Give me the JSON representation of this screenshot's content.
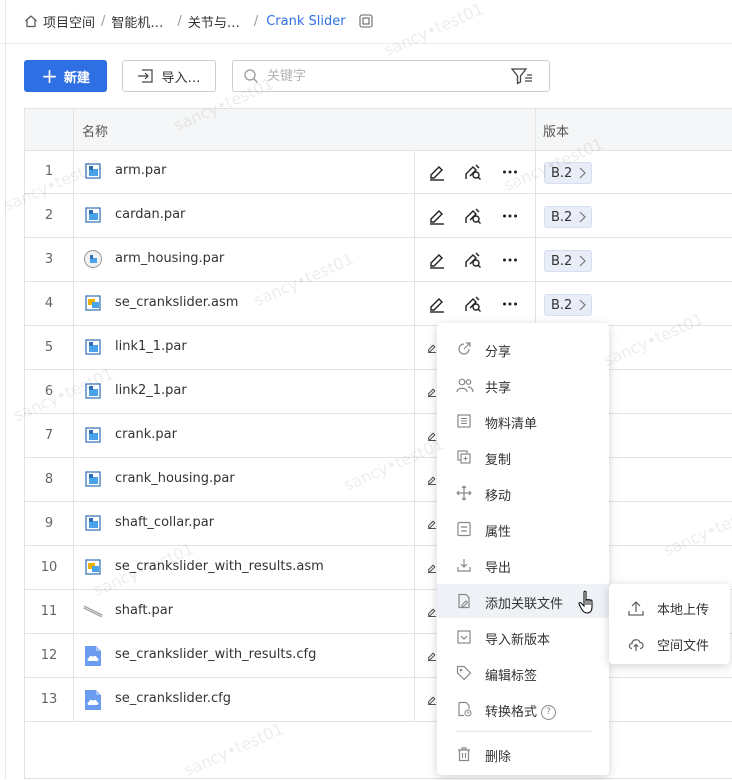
{
  "breadcrumb": {
    "items": [
      "项目空间",
      "智能机…",
      "关节与…"
    ],
    "current": "Crank Slider"
  },
  "toolbar": {
    "new_label": "新建",
    "import_label": "导入…",
    "search_placeholder": "关键字"
  },
  "table": {
    "header_name": "名称",
    "header_version": "版本",
    "rows": [
      {
        "num": "1",
        "name": "arm.par",
        "icon": "part-icon",
        "version": "B.2"
      },
      {
        "num": "2",
        "name": "cardan.par",
        "icon": "part-icon",
        "version": "B.2"
      },
      {
        "num": "3",
        "name": "arm_housing.par",
        "icon": "part-round-icon",
        "version": "B.2"
      },
      {
        "num": "4",
        "name": "se_crankslider.asm",
        "icon": "assembly-icon",
        "version": "B.2"
      },
      {
        "num": "5",
        "name": "link1_1.par",
        "icon": "part-icon"
      },
      {
        "num": "6",
        "name": "link2_1.par",
        "icon": "part-icon"
      },
      {
        "num": "7",
        "name": "crank.par",
        "icon": "part-icon"
      },
      {
        "num": "8",
        "name": "crank_housing.par",
        "icon": "part-icon"
      },
      {
        "num": "9",
        "name": "shaft_collar.par",
        "icon": "part-icon"
      },
      {
        "num": "10",
        "name": "se_crankslider_with_results.asm",
        "icon": "assembly-icon"
      },
      {
        "num": "11",
        "name": "shaft.par",
        "icon": "shaft-icon"
      },
      {
        "num": "12",
        "name": "se_crankslider_with_results.cfg",
        "icon": "cloud-file-icon"
      },
      {
        "num": "13",
        "name": "se_crankslider.cfg",
        "icon": "cloud-file-icon"
      }
    ]
  },
  "context_menu": {
    "items": [
      {
        "label": "分享",
        "icon": "share-icon"
      },
      {
        "label": "共享",
        "icon": "users-icon"
      },
      {
        "label": "物料清单",
        "icon": "bom-list-icon"
      },
      {
        "label": "复制",
        "icon": "copy-icon"
      },
      {
        "label": "移动",
        "icon": "move-icon"
      },
      {
        "label": "属性",
        "icon": "properties-icon"
      },
      {
        "label": "导出",
        "icon": "export-icon"
      },
      {
        "label": "添加关联文件",
        "icon": "attach-file-icon"
      },
      {
        "label": "导入新版本",
        "icon": "import-version-icon"
      },
      {
        "label": "编辑标签",
        "icon": "tag-icon"
      },
      {
        "label": "转换格式",
        "icon": "convert-icon"
      },
      {
        "label": "删除",
        "icon": "trash-icon"
      }
    ]
  },
  "submenu": {
    "items": [
      {
        "label": "本地上传",
        "icon": "upload-icon"
      },
      {
        "label": "空间文件",
        "icon": "cloud-upload-icon"
      }
    ]
  },
  "watermark": "sancy•test01",
  "colors": {
    "accent": "#2f6fe4",
    "badge_bg": "#e9edf7"
  }
}
